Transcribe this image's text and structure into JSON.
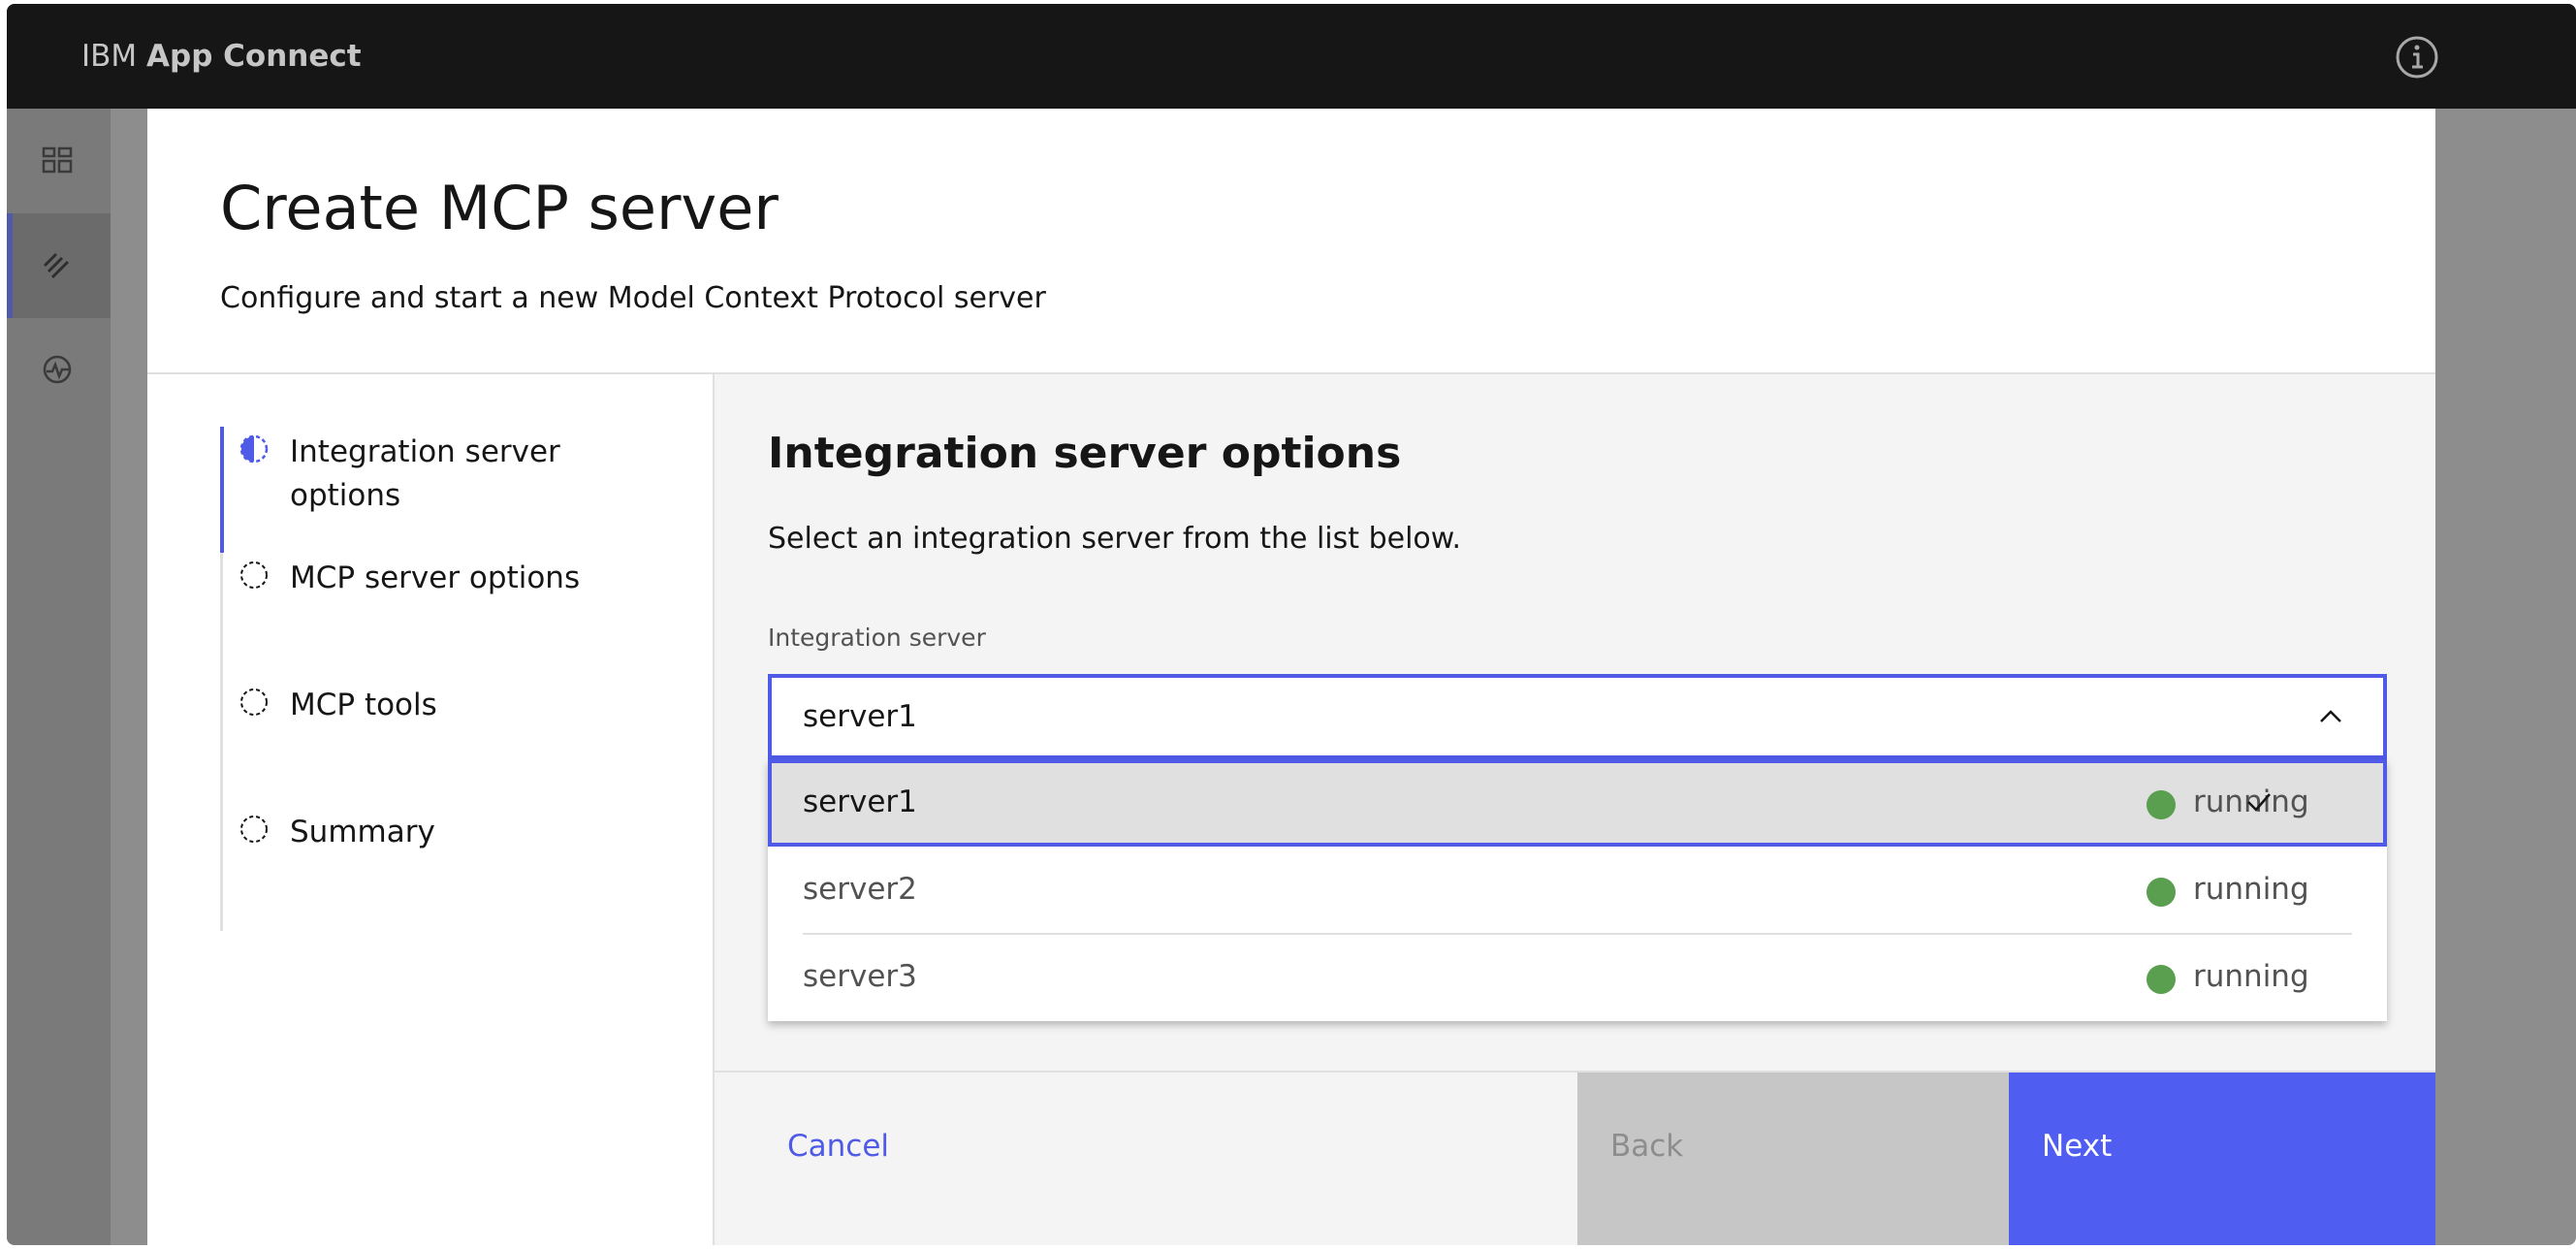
{
  "header": {
    "brand_prefix": "IBM",
    "brand_name": "App Connect"
  },
  "modal": {
    "title": "Create MCP server",
    "subtitle": "Configure and start a new Model Context Protocol server"
  },
  "steps": [
    {
      "label_line1": "Integration server",
      "label_line2": "options",
      "state": "current"
    },
    {
      "label_line1": "MCP server options",
      "label_line2": "",
      "state": "incomplete"
    },
    {
      "label_line1": "MCP tools",
      "label_line2": "",
      "state": "incomplete"
    },
    {
      "label_line1": "Summary",
      "label_line2": "",
      "state": "incomplete"
    }
  ],
  "content": {
    "section_title": "Integration server options",
    "section_desc": "Select an integration server from the list below.",
    "field_label": "Integration server",
    "selected_value": "server1",
    "options": [
      {
        "name": "server1",
        "status": "running",
        "selected": true
      },
      {
        "name": "server2",
        "status": "running",
        "selected": false
      },
      {
        "name": "server3",
        "status": "running",
        "selected": false
      }
    ]
  },
  "footer": {
    "cancel_label": "Cancel",
    "back_label": "Back",
    "next_label": "Next"
  },
  "colors": {
    "accent": "#4f5ae6",
    "status_running": "#5a9e4f"
  }
}
